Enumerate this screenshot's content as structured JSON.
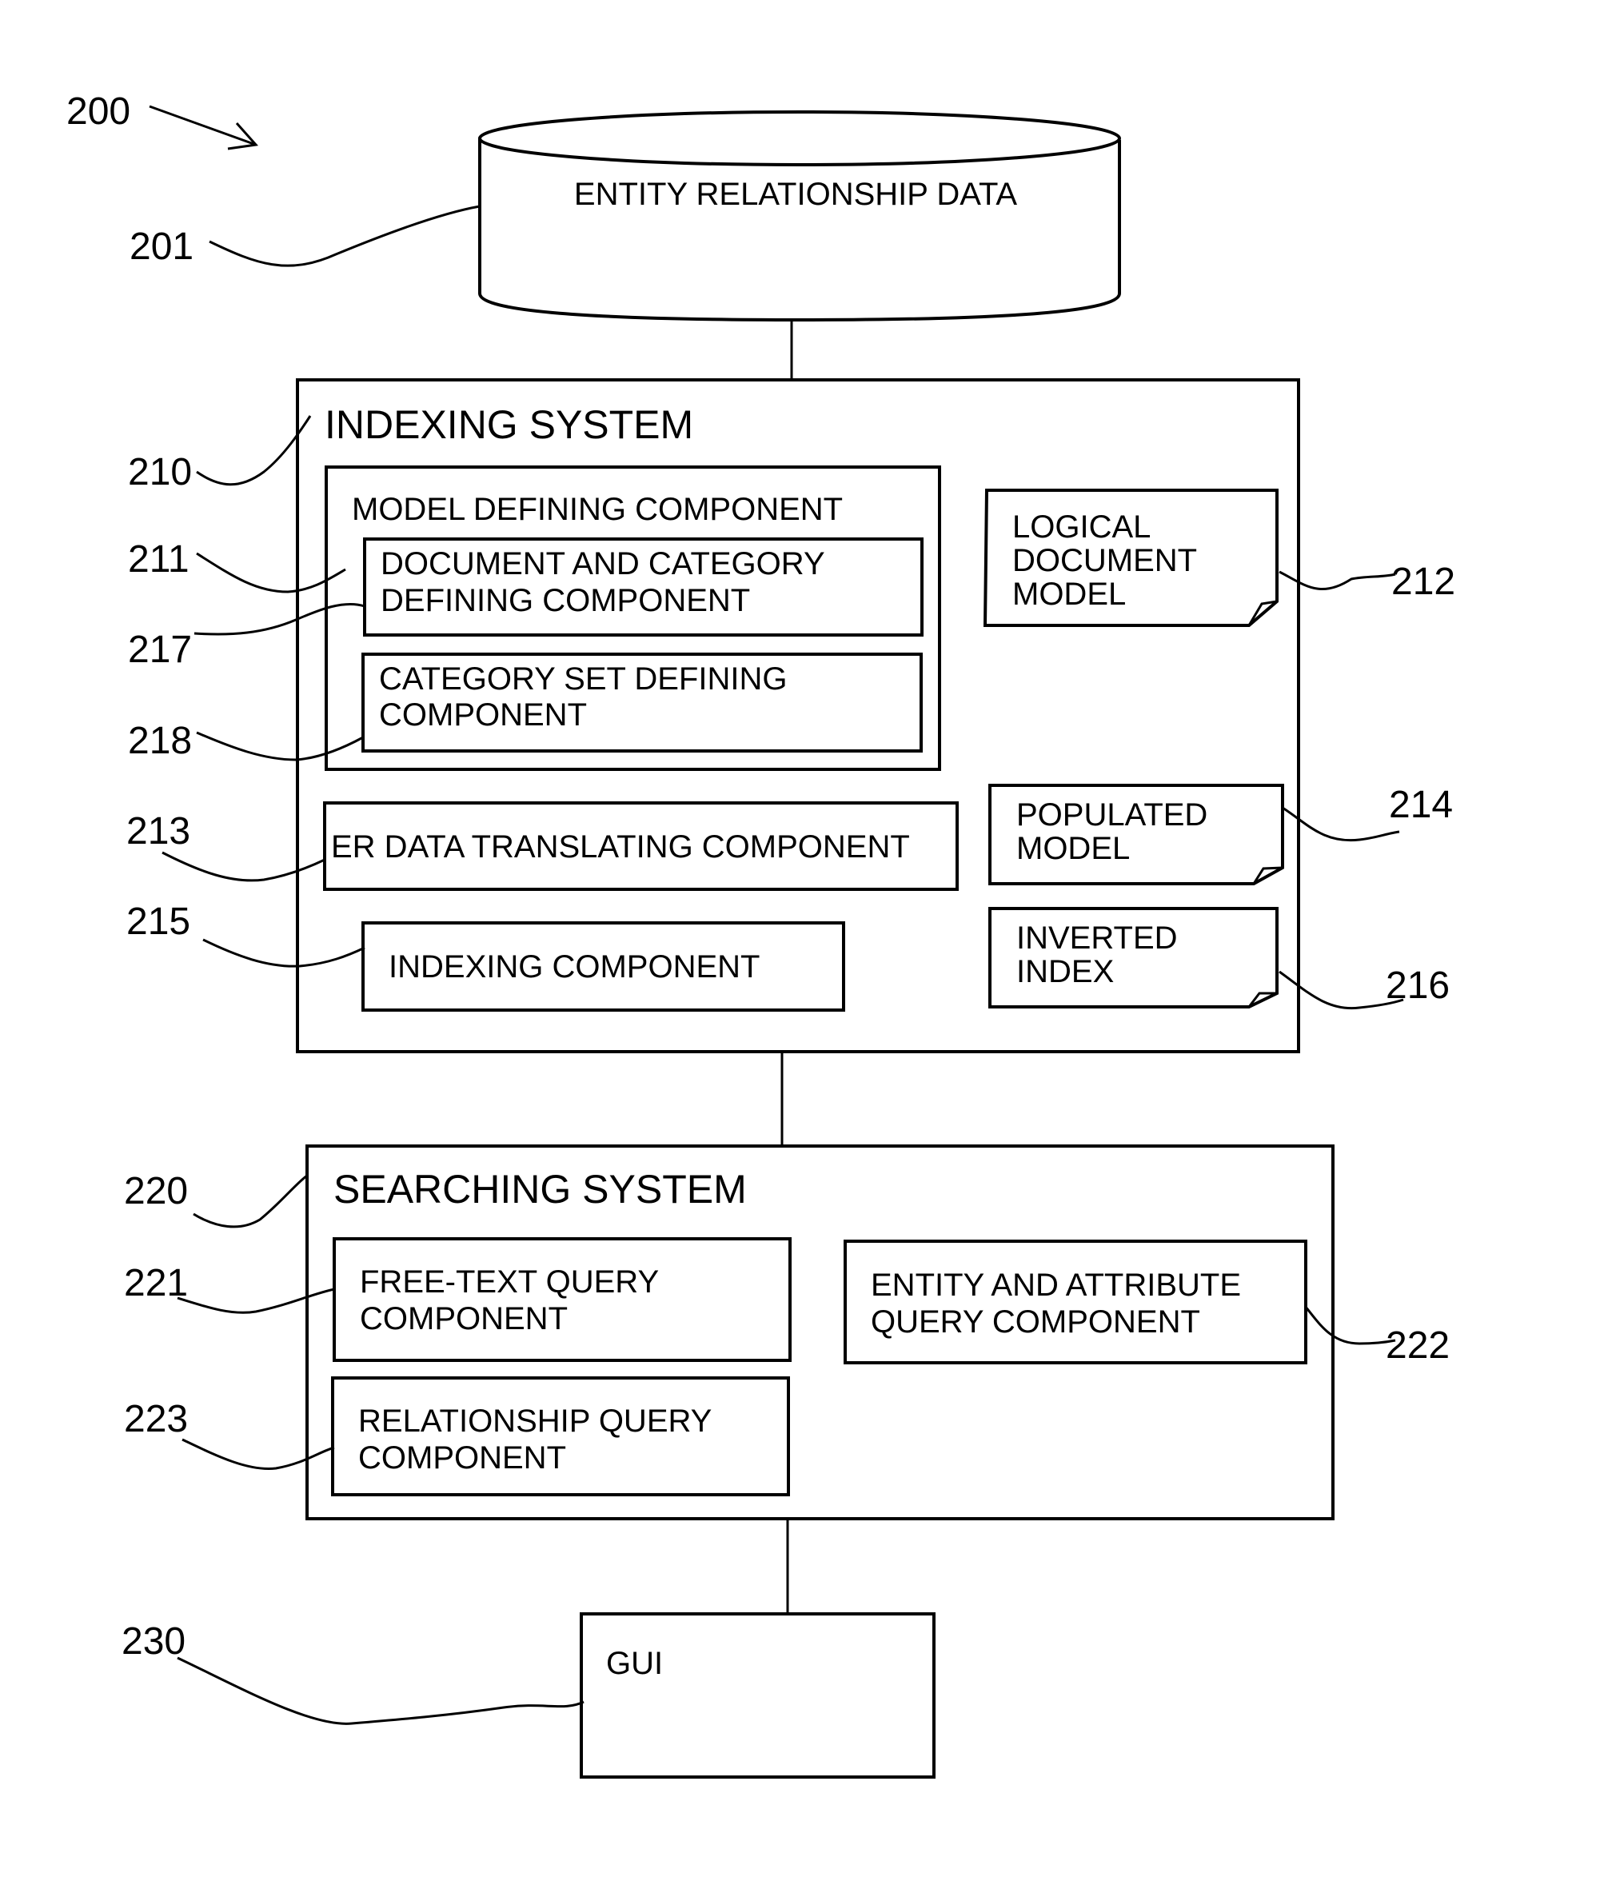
{
  "figure": {
    "ref": "200"
  },
  "database": {
    "ref": "201",
    "label": "ENTITY RELATIONSHIP DATA"
  },
  "indexing_system": {
    "ref": "210",
    "title": "INDEXING SYSTEM",
    "model_defining": {
      "ref": "211",
      "title": "MODEL DEFINING COMPONENT",
      "doc_category": {
        "ref": "217",
        "lines": [
          "DOCUMENT AND CATEGORY",
          "DEFINING COMPONENT"
        ]
      },
      "category_set": {
        "ref": "218",
        "lines": [
          "CATEGORY SET DEFINING",
          "COMPONENT"
        ]
      }
    },
    "er_translating": {
      "ref": "213",
      "label": "ER DATA TRANSLATING COMPONENT"
    },
    "indexing_component": {
      "ref": "215",
      "label": "INDEXING COMPONENT"
    },
    "logical_document_model": {
      "ref": "212",
      "lines": [
        "LOGICAL",
        "DOCUMENT",
        "MODEL"
      ]
    },
    "populated_model": {
      "ref": "214",
      "lines": [
        "POPULATED",
        "MODEL"
      ]
    },
    "inverted_index": {
      "ref": "216",
      "lines": [
        "INVERTED",
        "INDEX"
      ]
    }
  },
  "searching_system": {
    "ref": "220",
    "title": "SEARCHING SYSTEM",
    "free_text": {
      "ref": "221",
      "lines": [
        "FREE-TEXT QUERY",
        "COMPONENT"
      ]
    },
    "entity_attribute": {
      "ref": "222",
      "lines": [
        "ENTITY AND ATTRIBUTE",
        "QUERY COMPONENT"
      ]
    },
    "relationship": {
      "ref": "223",
      "lines": [
        "RELATIONSHIP QUERY",
        "COMPONENT"
      ]
    }
  },
  "gui": {
    "ref": "230",
    "label": "GUI"
  }
}
